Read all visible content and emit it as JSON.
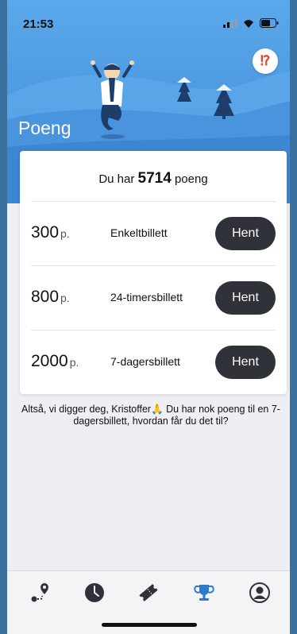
{
  "status_bar": {
    "time": "21:53"
  },
  "header": {
    "title": "Poeng",
    "alert_label": "⁉"
  },
  "balance": {
    "prefix": "Du har",
    "points": "5714",
    "suffix": "poeng"
  },
  "rewards": [
    {
      "points": "300",
      "unit": "p.",
      "name": "Enkeltbillett",
      "button": "Hent"
    },
    {
      "points": "800",
      "unit": "p.",
      "name": "24-timersbillett",
      "button": "Hent"
    },
    {
      "points": "2000",
      "unit": "p.",
      "name": "7-dagersbillett",
      "button": "Hent"
    }
  ],
  "message": "Altså, vi digger deg, Kristoffer🙏 Du har nok poeng til en 7-dagersbillett, hvordan får du det til?",
  "tabs": [
    {
      "icon": "route-icon",
      "active": false
    },
    {
      "icon": "clock-icon",
      "active": false
    },
    {
      "icon": "ticket-icon",
      "active": false
    },
    {
      "icon": "trophy-icon",
      "active": true
    },
    {
      "icon": "profile-icon",
      "active": false
    }
  ],
  "colors": {
    "accent": "#2f78cf",
    "icon": "#2f3339",
    "button": "#2f3339",
    "alert": "#e04627"
  }
}
